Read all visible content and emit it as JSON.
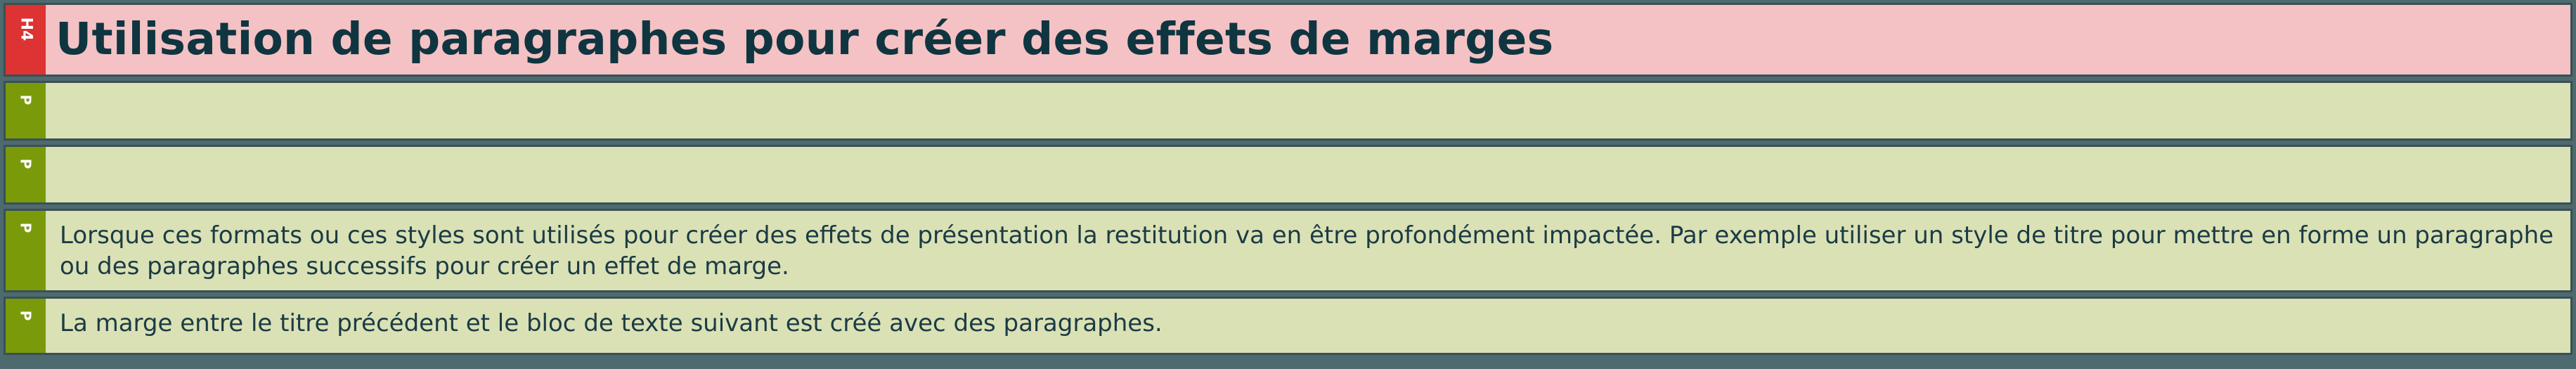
{
  "blocks": [
    {
      "tag": "H4",
      "text": "Utilisation de paragraphes pour créer des effets de marges"
    },
    {
      "tag": "P",
      "text": ""
    },
    {
      "tag": "P",
      "text": ""
    },
    {
      "tag": "P",
      "text": "Lorsque ces formats ou ces styles sont utilisés pour créer des effets de présentation la restitution va en être profondément impactée. Par exemple utiliser un style de titre pour mettre en forme un paragraphe ou des paragraphes successifs pour créer un effet de marge."
    },
    {
      "tag": "P",
      "text": "La marge entre le titre précédent et le bloc de texte suivant est créé avec des paragraphes."
    }
  ],
  "colors": {
    "background": "#4d6b6e",
    "h4_tag": "#dd3333",
    "h4_fill": "#f4c2c4",
    "p_tag": "#7b9a0a",
    "p_fill": "#dae1b5",
    "text": "#1b3b45"
  }
}
